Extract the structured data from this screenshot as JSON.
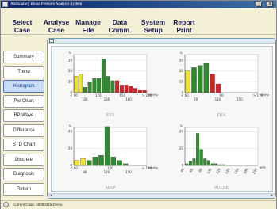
{
  "window": {
    "title": "Ambulatory Blood Pressure Analysis System"
  },
  "menu": [
    {
      "label": "Select\nCase"
    },
    {
      "label": "Analyse\nCase"
    },
    {
      "label": "Manage\nFile"
    },
    {
      "label": "Data\nComm."
    },
    {
      "label": "System\nSetup"
    },
    {
      "label": "Report\nPrint"
    }
  ],
  "sidebar": {
    "items": [
      {
        "label": "Summary"
      },
      {
        "label": "Trend"
      },
      {
        "label": "Histogram"
      },
      {
        "label": "Pie Chart"
      },
      {
        "label": "BP Wave"
      },
      {
        "label": "Difference"
      },
      {
        "label": "STD Chart"
      },
      {
        "label": "Discrete"
      },
      {
        "label": "Diagnosis"
      },
      {
        "label": "Return"
      }
    ],
    "active_index": 2
  },
  "status": {
    "text": "Current Case: 20050415  Demo"
  },
  "colors": {
    "low": "#f0e030",
    "normal": "#2e8b2e",
    "high": "#d42020"
  },
  "chart_data": [
    {
      "type": "bar",
      "title": "SYS",
      "unit": "mmHg",
      "ylabel": "%",
      "y_ticks": [
        0,
        10,
        20,
        30
      ],
      "ylim": [
        0,
        35
      ],
      "x_ticks": [
        "< 90",
        "120",
        "150",
        "> 200",
        "100",
        "130",
        "180"
      ],
      "values": [
        15,
        17,
        5,
        10,
        13,
        13,
        31,
        15,
        11,
        11,
        7,
        7,
        6,
        4,
        2,
        2
      ],
      "bar_classes": [
        "low",
        "low",
        "normal",
        "normal",
        "normal",
        "normal",
        "normal",
        "normal",
        "normal",
        "high",
        "high",
        "high",
        "high",
        "high",
        "high",
        "high"
      ]
    },
    {
      "type": "bar",
      "title": "DIA",
      "unit": "mmHg",
      "ylabel": "%",
      "y_ticks": [
        0,
        10,
        20,
        30
      ],
      "ylim": [
        0,
        35
      ],
      "x_ticks": [
        "< 60",
        "90",
        "> 170",
        "70",
        "110",
        "150"
      ],
      "values": [
        20,
        23,
        25,
        27,
        17,
        8,
        0,
        0,
        0,
        0,
        0,
        0
      ],
      "bar_classes": [
        "low",
        "normal",
        "normal",
        "normal",
        "high",
        "high",
        "high",
        "high",
        "high",
        "high",
        "high",
        "high"
      ]
    },
    {
      "type": "bar",
      "title": "MAP",
      "unit": "mmHg",
      "ylabel": "%",
      "y_ticks": [
        0,
        20,
        40
      ],
      "ylim": [
        0,
        45
      ],
      "x_ticks": [
        "< 60",
        "100",
        "> 180",
        "80",
        "120",
        "150"
      ],
      "values": [
        6,
        8,
        6,
        10,
        12,
        46,
        10,
        6,
        2,
        0,
        0,
        0
      ],
      "bar_classes": [
        "low",
        "low",
        "normal",
        "normal",
        "normal",
        "normal",
        "normal",
        "normal",
        "normal",
        "normal",
        "normal",
        "normal"
      ]
    },
    {
      "type": "bar",
      "title": "PULSE",
      "unit": "BPM",
      "ylabel": "%",
      "y_ticks": [
        0,
        20,
        40
      ],
      "ylim": [
        0,
        45
      ],
      "x_ticks": [
        "40",
        "60",
        "80",
        "100",
        "120",
        "140",
        "160",
        "180",
        "200"
      ],
      "values": [
        2,
        5,
        8,
        38,
        19,
        8,
        6,
        2,
        2,
        1,
        1,
        0,
        0,
        0,
        0,
        0,
        0,
        0,
        0,
        0
      ],
      "bar_classes": [
        "normal",
        "normal",
        "normal",
        "normal",
        "normal",
        "normal",
        "normal",
        "normal",
        "normal",
        "normal",
        "normal",
        "normal",
        "normal",
        "normal",
        "normal",
        "normal",
        "normal",
        "normal",
        "normal",
        "normal"
      ]
    }
  ]
}
